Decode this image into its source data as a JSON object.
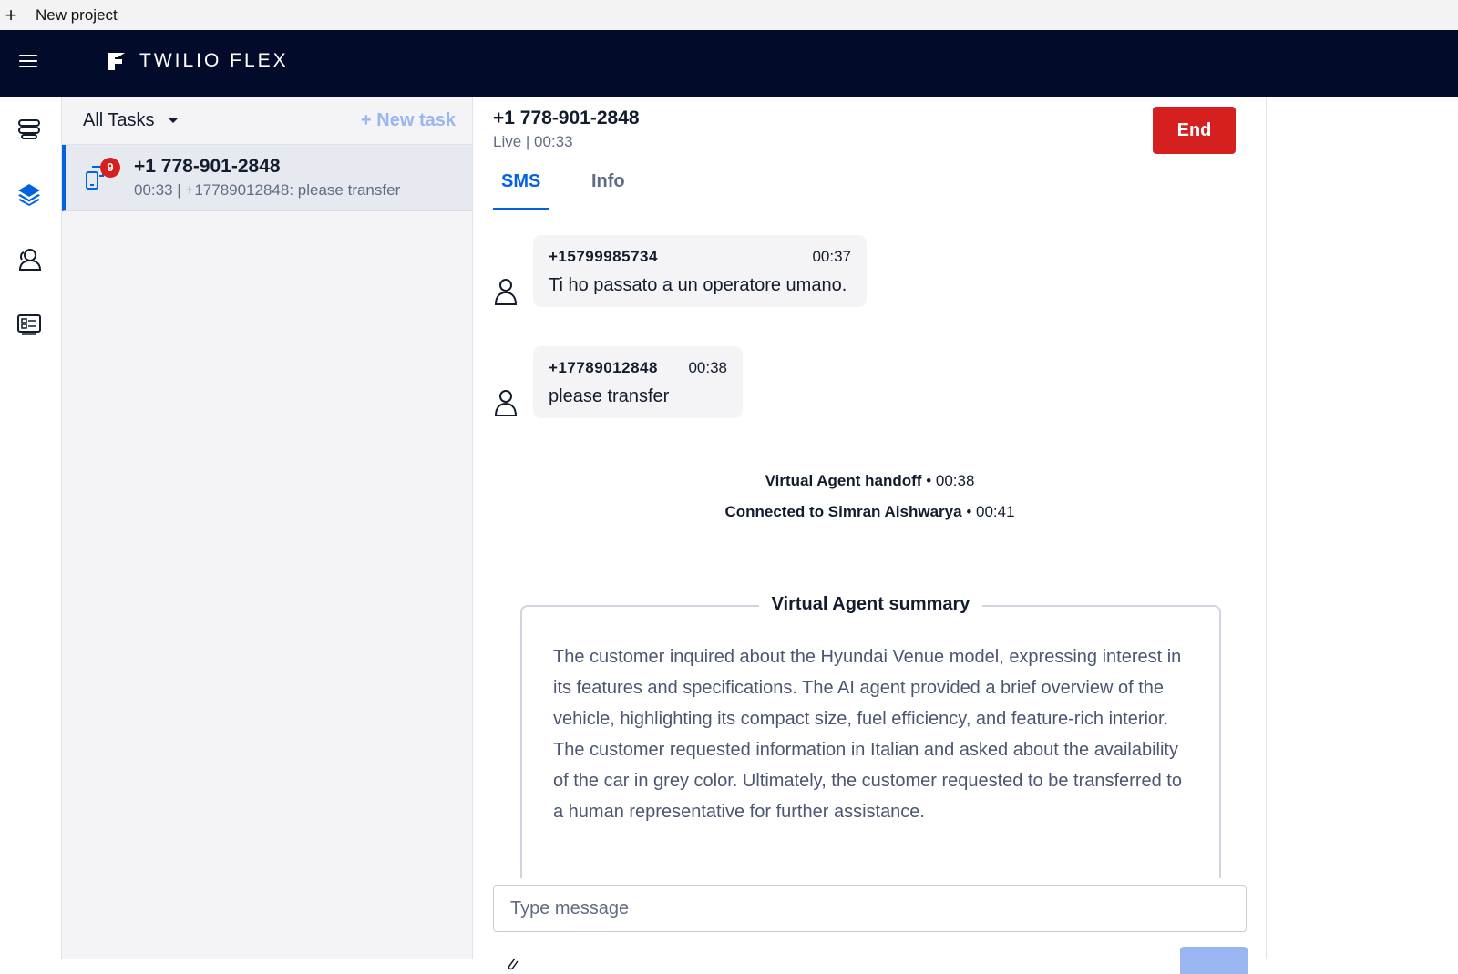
{
  "os_bar": {
    "action_label": "New project"
  },
  "app": {
    "brand": "TWILIO FLEX"
  },
  "nav": {
    "items": [
      {
        "icon": "queues-icon"
      },
      {
        "icon": "layers-icon"
      },
      {
        "icon": "teams-icon"
      },
      {
        "icon": "dashboard-icon"
      }
    ]
  },
  "tasklist": {
    "filter_label": "All Tasks",
    "new_task_label": "+ New task",
    "tasks": [
      {
        "title": "+1 778-901-2848",
        "badge": "9",
        "subtitle": "00:33 | +17789012848: please transfer"
      }
    ]
  },
  "conversation": {
    "title": "+1 778-901-2848",
    "status": "Live | 00:33",
    "end_label": "End",
    "tabs": [
      {
        "label": "SMS"
      },
      {
        "label": "Info"
      }
    ],
    "messages": [
      {
        "from": "+15799985734",
        "time": "00:37",
        "text": "Ti ho passato a un operatore umano."
      },
      {
        "from": "+17789012848",
        "time": "00:38",
        "text": "please transfer"
      }
    ],
    "events": [
      {
        "label": "Virtual Agent handoff",
        "time": "• 00:38"
      },
      {
        "label": "Connected to Simran Aishwarya",
        "time": "• 00:41"
      }
    ],
    "summary": {
      "title": "Virtual Agent summary",
      "text": "The customer inquired about the Hyundai Venue model, expressing interest in its features and specifications. The AI agent provided a brief overview of the vehicle, highlighting its compact size, fuel efficiency, and feature-rich interior. The customer requested information in Italian and asked about the availability of the car in grey color. Ultimately, the customer requested to be transferred to a human representative for further assistance."
    },
    "composer": {
      "placeholder": "Type message"
    }
  },
  "colors": {
    "topbar": "#030b2b",
    "accent": "#0263e0",
    "danger": "#d61f1f"
  }
}
